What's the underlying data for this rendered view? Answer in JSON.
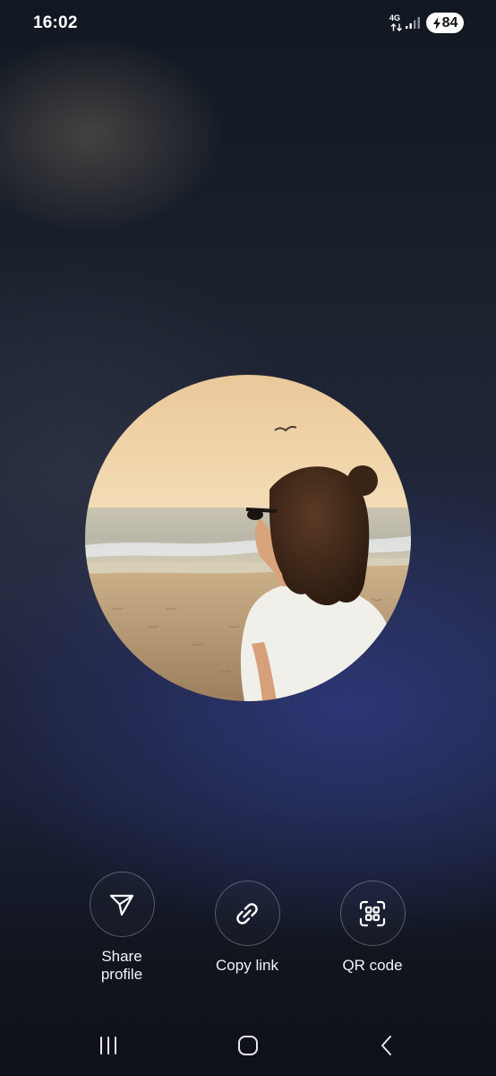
{
  "status_bar": {
    "time": "16:02",
    "network_type": "4G",
    "battery_level": "84",
    "icons": [
      "network-arrows-icon",
      "signal-icon",
      "charging-bolt-icon"
    ]
  },
  "avatar": {
    "description_icon": "profile-photo"
  },
  "actions": [
    {
      "label": "Share profile",
      "icon": "send-icon"
    },
    {
      "label": "Copy link",
      "icon": "link-icon"
    },
    {
      "label": "QR code",
      "icon": "qr-scan-icon"
    }
  ],
  "nav_bar": {
    "icons": [
      "recent-apps-icon",
      "home-icon",
      "back-icon"
    ]
  },
  "colors": {
    "background_top": "#121822",
    "background_glow": "#2d3778",
    "text": "#ffffff"
  }
}
